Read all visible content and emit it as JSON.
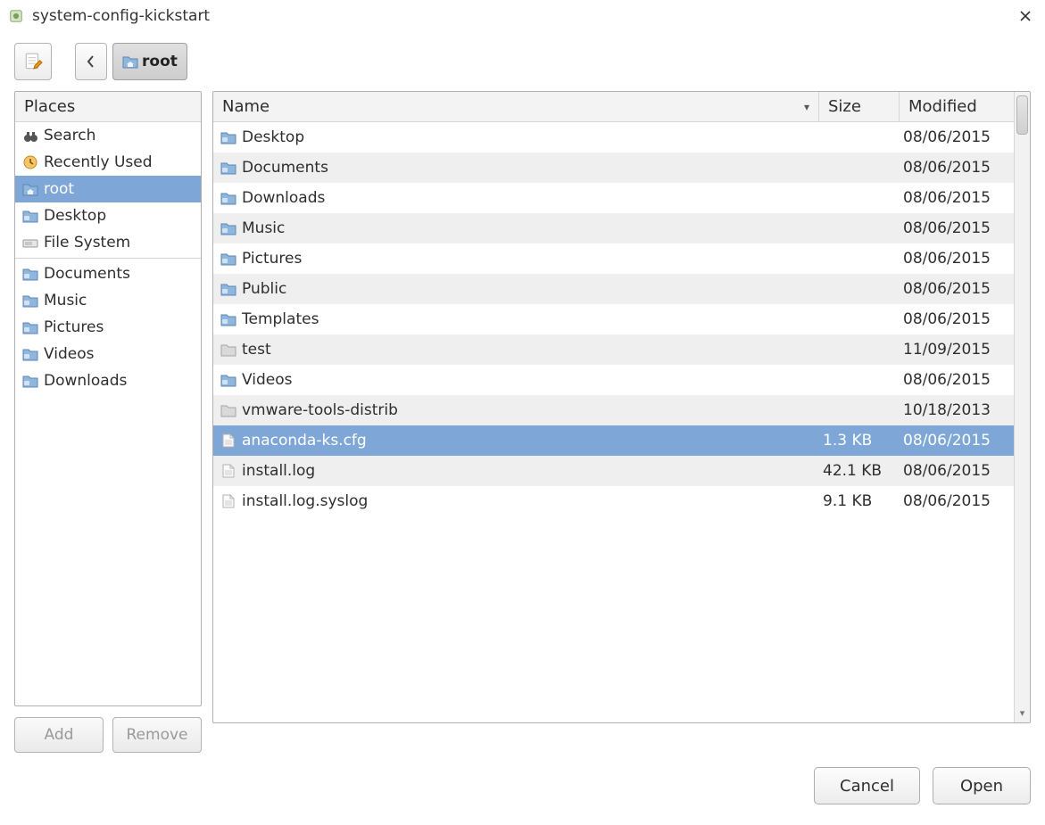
{
  "window": {
    "title": "system-config-kickstart"
  },
  "toolbar": {
    "breadcrumb_label": "root"
  },
  "places": {
    "header": "Places",
    "items": [
      {
        "icon": "binoculars",
        "label": "Search",
        "selected": false
      },
      {
        "icon": "recent",
        "label": "Recently Used",
        "selected": false
      },
      {
        "icon": "home",
        "label": "root",
        "selected": true
      },
      {
        "icon": "folder",
        "label": "Desktop",
        "selected": false
      },
      {
        "icon": "drive",
        "label": "File System",
        "selected": false
      }
    ],
    "bookmarks": [
      {
        "icon": "folder",
        "label": "Documents"
      },
      {
        "icon": "folder",
        "label": "Music"
      },
      {
        "icon": "folder",
        "label": "Pictures"
      },
      {
        "icon": "folder",
        "label": "Videos"
      },
      {
        "icon": "folder",
        "label": "Downloads"
      }
    ],
    "add_label": "Add",
    "remove_label": "Remove"
  },
  "files": {
    "columns": {
      "name": "Name",
      "size": "Size",
      "modified": "Modified"
    },
    "rows": [
      {
        "icon": "folder",
        "name": "Desktop",
        "size": "",
        "modified": "08/06/2015",
        "selected": false
      },
      {
        "icon": "folder",
        "name": "Documents",
        "size": "",
        "modified": "08/06/2015",
        "selected": false
      },
      {
        "icon": "folder",
        "name": "Downloads",
        "size": "",
        "modified": "08/06/2015",
        "selected": false
      },
      {
        "icon": "folder",
        "name": "Music",
        "size": "",
        "modified": "08/06/2015",
        "selected": false
      },
      {
        "icon": "folder",
        "name": "Pictures",
        "size": "",
        "modified": "08/06/2015",
        "selected": false
      },
      {
        "icon": "folder",
        "name": "Public",
        "size": "",
        "modified": "08/06/2015",
        "selected": false
      },
      {
        "icon": "folder",
        "name": "Templates",
        "size": "",
        "modified": "08/06/2015",
        "selected": false
      },
      {
        "icon": "folder-plain",
        "name": "test",
        "size": "",
        "modified": "11/09/2015",
        "selected": false
      },
      {
        "icon": "folder",
        "name": "Videos",
        "size": "",
        "modified": "08/06/2015",
        "selected": false
      },
      {
        "icon": "folder-plain",
        "name": "vmware-tools-distrib",
        "size": "",
        "modified": "10/18/2013",
        "selected": false
      },
      {
        "icon": "file",
        "name": "anaconda-ks.cfg",
        "size": "1.3 KB",
        "modified": "08/06/2015",
        "selected": true
      },
      {
        "icon": "file",
        "name": "install.log",
        "size": "42.1 KB",
        "modified": "08/06/2015",
        "selected": false
      },
      {
        "icon": "file",
        "name": "install.log.syslog",
        "size": "9.1 KB",
        "modified": "08/06/2015",
        "selected": false
      }
    ]
  },
  "buttons": {
    "cancel": "Cancel",
    "open": "Open"
  }
}
